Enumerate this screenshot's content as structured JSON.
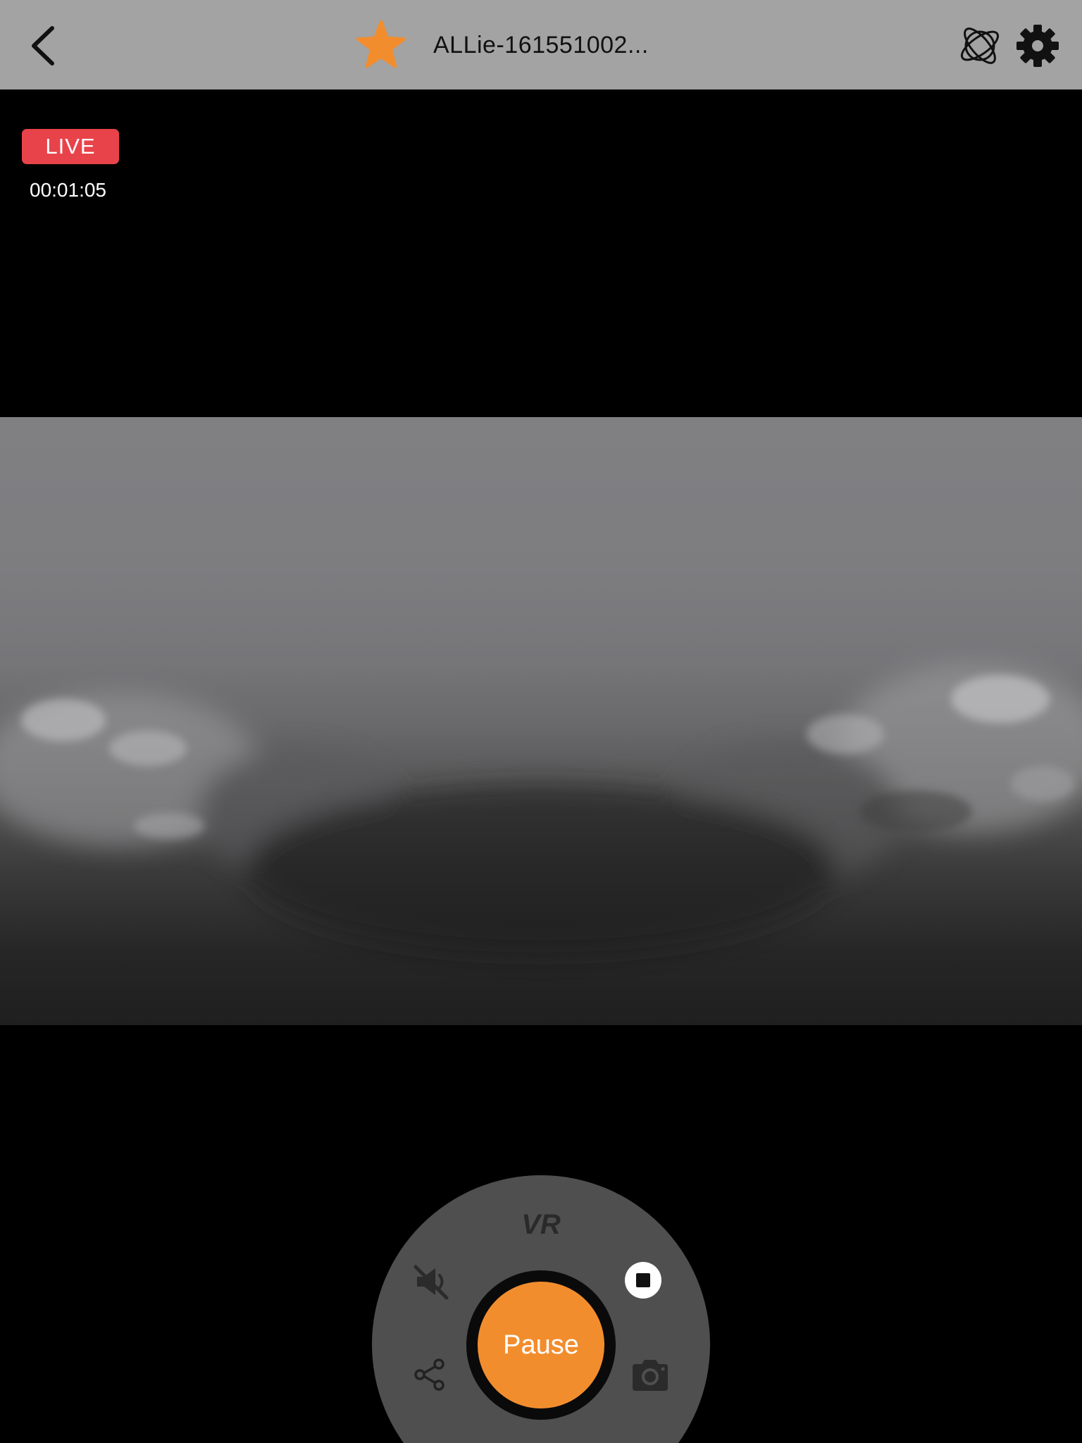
{
  "header": {
    "title": "ALLie-161551002...",
    "back_icon": "chevron-left-icon",
    "favorite_icon": "star-icon",
    "vr_mode_icon": "orbit-globe-icon",
    "settings_icon": "gear-icon"
  },
  "stream": {
    "live_label": "LIVE",
    "elapsed": "00:01:05"
  },
  "controls": {
    "vr_label": "VR",
    "pause_label": "Pause",
    "mute_icon": "speaker-muted-icon",
    "stop_icon": "stop-icon",
    "share_icon": "share-icon",
    "camera_icon": "camera-icon"
  },
  "colors": {
    "header_bg": "#a3a3a3",
    "accent_orange": "#f28d2e",
    "live_red": "#e8434a",
    "dial_bg": "#4f4f4f"
  }
}
